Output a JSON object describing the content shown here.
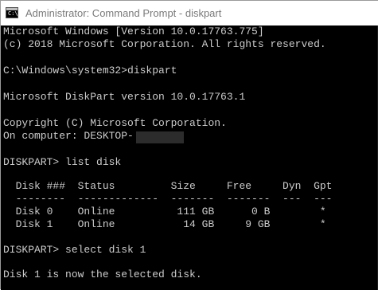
{
  "window": {
    "title": "Administrator: Command Prompt - diskpart",
    "icon": "cmd-console-icon",
    "icon_glyph": "C:\\"
  },
  "console": {
    "background": "#000000",
    "foreground": "#cccccc",
    "lines": [
      "Microsoft Windows [Version 10.0.17763.775]",
      "(c) 2018 Microsoft Corporation. All rights reserved.",
      "",
      "C:\\Windows\\system32>diskpart",
      "",
      "Microsoft DiskPart version 10.0.17763.1",
      "",
      "Copyright (C) Microsoft Corporation.",
      "On computer: DESKTOP-",
      "",
      "DISKPART> list disk",
      "",
      "  Disk ###  Status         Size     Free     Dyn  Gpt",
      "  --------  -------------  -------  -------  ---  ---",
      "  Disk 0    Online          111 GB      0 B        *",
      "  Disk 1    Online           14 GB     9 GB        *",
      "",
      "DISKPART> select disk 1",
      "",
      "Disk 1 is now the selected disk."
    ]
  }
}
